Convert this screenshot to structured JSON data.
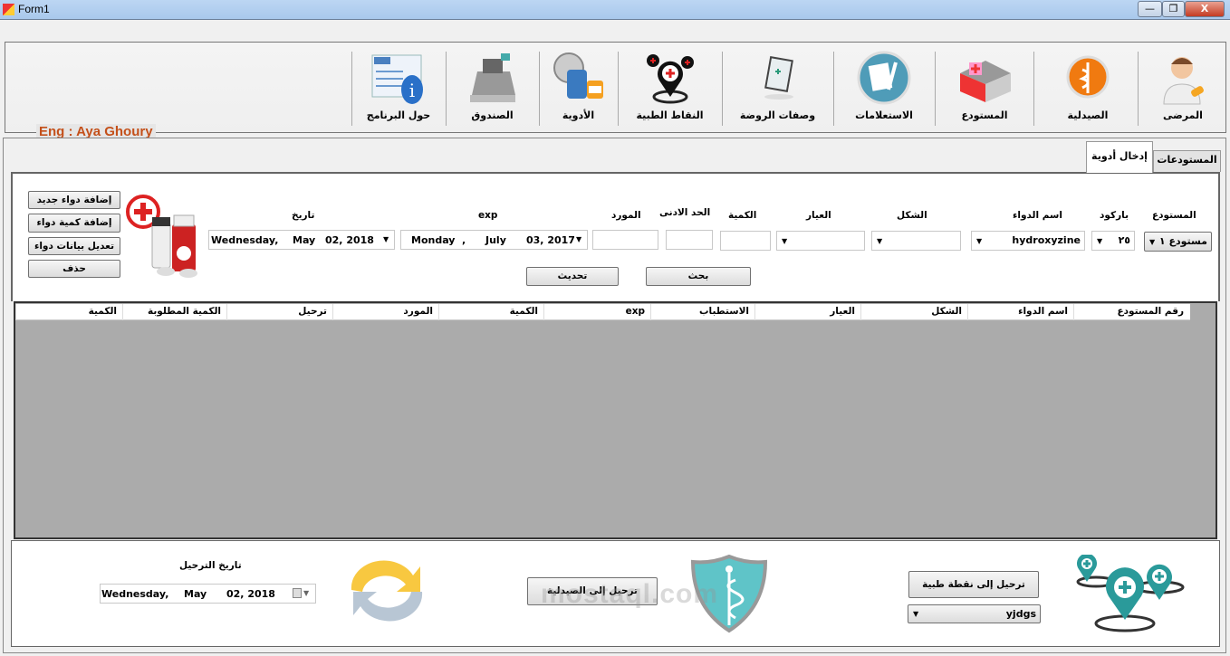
{
  "window": {
    "title": "Form1",
    "minimize": "—",
    "maximize": "❐",
    "close": "X"
  },
  "toolbar": {
    "author": "Eng : Aya Ghoury",
    "items": [
      {
        "label": "المرضى",
        "icon": "doctor-icon"
      },
      {
        "label": "الصيدلية",
        "icon": "pharmacy-icon"
      },
      {
        "label": "المستودع",
        "icon": "warehouse-icon"
      },
      {
        "label": "الاستعلامات",
        "icon": "inquiries-icon"
      },
      {
        "label": "وصفات الروضة",
        "icon": "prescription-icon"
      },
      {
        "label": "النقاط الطبية",
        "icon": "medical-points-icon"
      },
      {
        "label": "الأدوية",
        "icon": "medicines-icon"
      },
      {
        "label": "الصندوق",
        "icon": "cash-register-icon"
      },
      {
        "label": "حول البرنامج",
        "icon": "about-icon"
      }
    ]
  },
  "tabs": [
    {
      "label": "المستودعات",
      "active": false
    },
    {
      "label": "إدخال أدوية",
      "active": true
    }
  ],
  "form": {
    "warehouse": {
      "label": "المستودع",
      "value": "مستودع ١"
    },
    "barcode": {
      "label": "باركود",
      "value": "٢٥"
    },
    "drug_name": {
      "label": "اسم الدواء",
      "value": "hydroxyzine"
    },
    "form_shape": {
      "label": "الشكل",
      "value": ""
    },
    "strength": {
      "label": "العيار",
      "value": ""
    },
    "quantity": {
      "label": "الكمية",
      "value": ""
    },
    "min_limit": {
      "label": "الحد الادنى",
      "value": ""
    },
    "supplier": {
      "label": "المورد",
      "value": ""
    },
    "exp": {
      "label": "exp",
      "day": "Monday",
      "sep": ",",
      "month": "July",
      "date": "03, 2017"
    },
    "date": {
      "label": "تاريخ",
      "day": "Wednesday,",
      "month": "May",
      "date": "02, 2018"
    },
    "search_btn": "بحث",
    "refresh_btn": "تحديث",
    "side_buttons": [
      "إضافة دواء جديد",
      "إضافة كمية دواء",
      "تعديل بيانات دواء",
      "حذف"
    ]
  },
  "grid": {
    "columns": [
      "رقم المستودع",
      "اسم الدواء",
      "الشكل",
      "العيار",
      "الاستطباب",
      "exp",
      "الكمية",
      "المورد",
      "ترحيل",
      "الكمية المطلوبة",
      "الكمية"
    ]
  },
  "bottom": {
    "transfer_date_label": "تاريخ الترحيل",
    "transfer_date": {
      "day": "Wednesday,",
      "month": "May",
      "date": "02, 2018"
    },
    "to_pharmacy_btn": "ترحيل إلى الصيدلية",
    "to_point_btn": "ترحيل إلى نقطة طبية",
    "point_value": "yjdgs"
  },
  "watermark": "mostaql.com",
  "colors": {
    "author": "#c4501a",
    "teal": "#2a9a9a",
    "grid_bg": "#ababab"
  }
}
